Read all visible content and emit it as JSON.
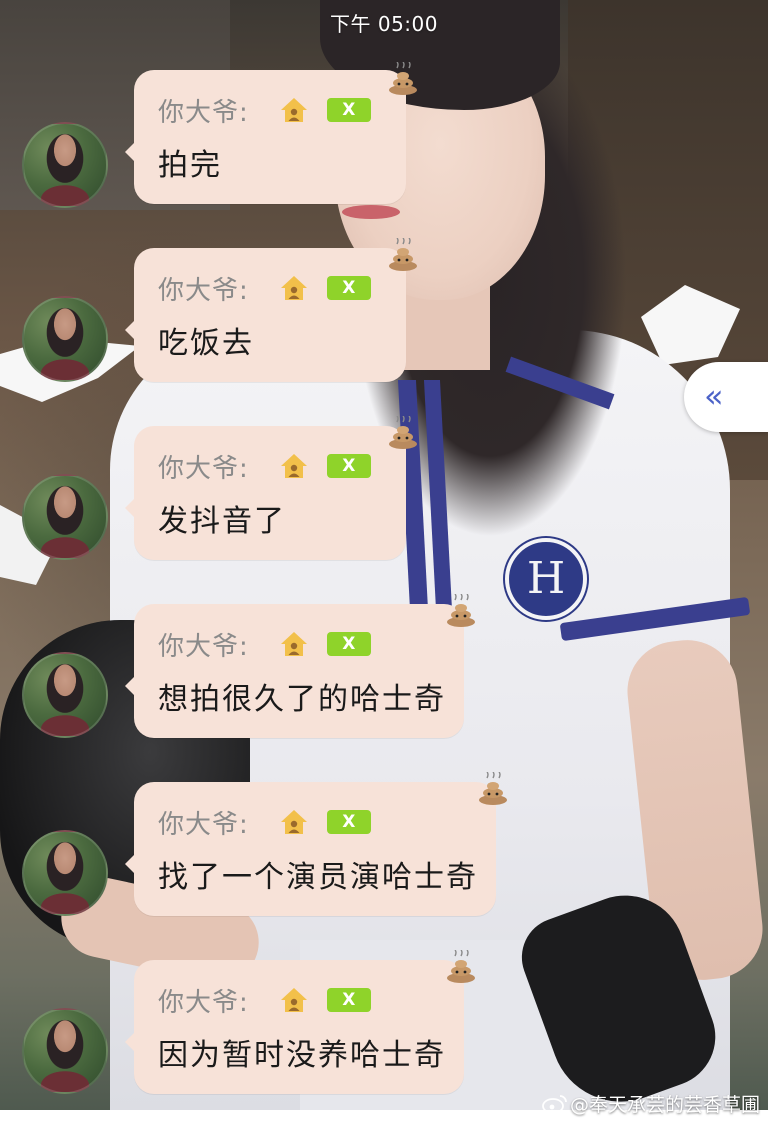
{
  "status_bar": {
    "time": "下午 05:00"
  },
  "messages": [
    {
      "sender": "你大爷:",
      "badge": "X",
      "text": "拍完"
    },
    {
      "sender": "你大爷:",
      "badge": "X",
      "text": "吃饭去"
    },
    {
      "sender": "你大爷:",
      "badge": "X",
      "text": "发抖音了"
    },
    {
      "sender": "你大爷:",
      "badge": "X",
      "text": "想拍很久了的哈士奇"
    },
    {
      "sender": "你大爷:",
      "badge": "X",
      "text": "找了一个演员演哈士奇"
    },
    {
      "sender": "你大爷:",
      "badge": "X",
      "text": "因为暂时没养哈士奇"
    }
  ],
  "collapse_handle": {
    "label": "«"
  },
  "watermark": {
    "text": "@奉天承芸的芸香草圃"
  },
  "icons": {
    "avatar": "avatar-photo",
    "group": "home-icon",
    "reaction": "poop-icon",
    "watermark": "weibo-icon"
  },
  "colors": {
    "bubble": "#f7e2d8",
    "badge": "#8fd32a",
    "sender": "#8a8a8a",
    "message": "#1a1a1a",
    "handle_arrow": "#4b62c8"
  }
}
